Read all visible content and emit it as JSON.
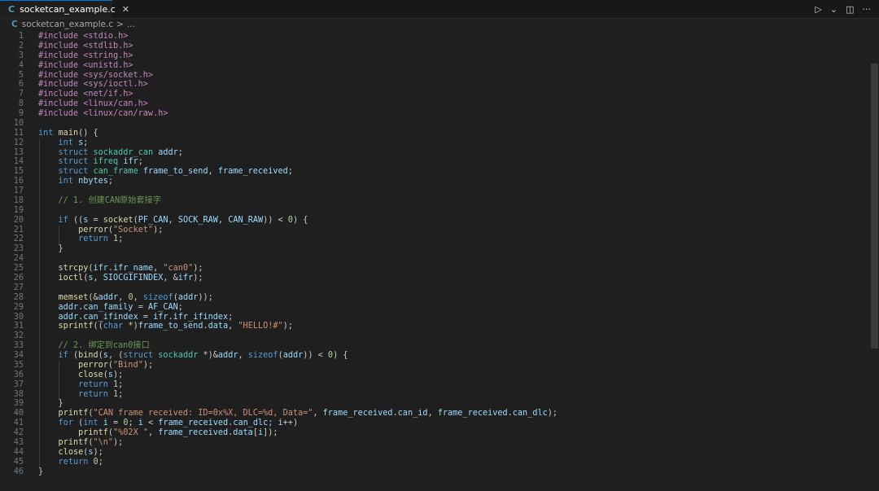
{
  "tab": {
    "icon": "C",
    "filename": "socketcan_example.c",
    "close": "✕"
  },
  "breadcrumb": {
    "icon": "C",
    "file": "socketcan_example.c",
    "separator": ">",
    "more": "..."
  },
  "editor_actions": {
    "run": "▷",
    "run_dropdown": "⌄",
    "split": "◫",
    "more": "···"
  },
  "code_lines": [
    {
      "n": "1",
      "t": "#include <stdio.h>",
      "k": "pp"
    },
    {
      "n": "2",
      "t": "#include <stdlib.h>",
      "k": "pp"
    },
    {
      "n": "3",
      "t": "#include <string.h>",
      "k": "pp"
    },
    {
      "n": "4",
      "t": "#include <unistd.h>",
      "k": "pp"
    },
    {
      "n": "5",
      "t": "#include <sys/socket.h>",
      "k": "pp"
    },
    {
      "n": "6",
      "t": "#include <sys/ioctl.h>",
      "k": "pp"
    },
    {
      "n": "7",
      "t": "#include <net/if.h>",
      "k": "pp"
    },
    {
      "n": "8",
      "t": "#include <linux/can.h>",
      "k": "pp"
    },
    {
      "n": "9",
      "t": "#include <linux/can/raw.h>",
      "k": "pp"
    },
    {
      "n": "10",
      "t": "",
      "k": ""
    },
    {
      "n": "11",
      "t": "int main() {",
      "k": ""
    },
    {
      "n": "12",
      "t": "    int s;",
      "k": ""
    },
    {
      "n": "13",
      "t": "    struct sockaddr_can addr;",
      "k": ""
    },
    {
      "n": "14",
      "t": "    struct ifreq ifr;",
      "k": ""
    },
    {
      "n": "15",
      "t": "    struct can_frame frame_to_send, frame_received;",
      "k": ""
    },
    {
      "n": "16",
      "t": "    int nbytes;",
      "k": ""
    },
    {
      "n": "17",
      "t": "",
      "k": ""
    },
    {
      "n": "18",
      "t": "    // 1. 创建CAN原始套接字",
      "k": "cm"
    },
    {
      "n": "19",
      "t": "",
      "k": ""
    },
    {
      "n": "20",
      "t": "    if ((s = socket(PF_CAN, SOCK_RAW, CAN_RAW)) < 0) {",
      "k": ""
    },
    {
      "n": "21",
      "t": "        perror(\"Socket\");",
      "k": ""
    },
    {
      "n": "22",
      "t": "        return 1;",
      "k": ""
    },
    {
      "n": "23",
      "t": "    }",
      "k": ""
    },
    {
      "n": "24",
      "t": "",
      "k": ""
    },
    {
      "n": "25",
      "t": "    strcpy(ifr.ifr_name, \"can0\");",
      "k": ""
    },
    {
      "n": "26",
      "t": "    ioctl(s, SIOCGIFINDEX, &ifr);",
      "k": ""
    },
    {
      "n": "27",
      "t": "",
      "k": ""
    },
    {
      "n": "28",
      "t": "    memset(&addr, 0, sizeof(addr));",
      "k": ""
    },
    {
      "n": "29",
      "t": "    addr.can_family = AF_CAN;",
      "k": ""
    },
    {
      "n": "30",
      "t": "    addr.can_ifindex = ifr.ifr_ifindex;",
      "k": ""
    },
    {
      "n": "31",
      "t": "    sprintf((char *)frame_to_send.data, \"HELLO!#\");",
      "k": ""
    },
    {
      "n": "32",
      "t": "",
      "k": ""
    },
    {
      "n": "33",
      "t": "    // 2. 绑定到can0接口",
      "k": "cm"
    },
    {
      "n": "34",
      "t": "    if (bind(s, (struct sockaddr *)&addr, sizeof(addr)) < 0) {",
      "k": ""
    },
    {
      "n": "35",
      "t": "        perror(\"Bind\");",
      "k": ""
    },
    {
      "n": "36",
      "t": "        close(s);",
      "k": ""
    },
    {
      "n": "37",
      "t": "        return 1;",
      "k": ""
    },
    {
      "n": "38",
      "t": "        return 1;",
      "k": ""
    },
    {
      "n": "39",
      "t": "    }",
      "k": ""
    },
    {
      "n": "40",
      "t": "    printf(\"CAN frame received: ID=0x%X, DLC=%d, Data=\", frame_received.can_id, frame_received.can_dlc);",
      "k": ""
    },
    {
      "n": "41",
      "t": "    for (int i = 0; i < frame_received.can_dlc; i++)",
      "k": ""
    },
    {
      "n": "42",
      "t": "        printf(\"%02X \", frame_received.data[i]);",
      "k": ""
    },
    {
      "n": "43",
      "t": "    printf(\"\\n\");",
      "k": ""
    },
    {
      "n": "44",
      "t": "    close(s);",
      "k": ""
    },
    {
      "n": "45",
      "t": "    return 0;",
      "k": ""
    },
    {
      "n": "46",
      "t": "}",
      "k": ""
    }
  ]
}
